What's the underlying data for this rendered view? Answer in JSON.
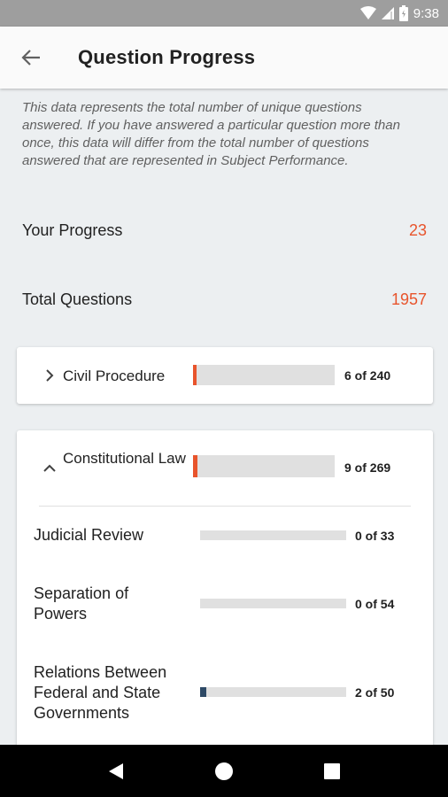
{
  "status_bar": {
    "time": "9:38"
  },
  "app_bar": {
    "title": "Question Progress"
  },
  "disclaimer": "This data represents the total number of unique questions answered. If you have answered a particular question more than once, this data will differ from the total number of questions answered that are represented in Subject Performance.",
  "stats": {
    "progress_label": "Your Progress",
    "progress_value": "23",
    "total_label": "Total Questions",
    "total_value": "1957"
  },
  "subjects": [
    {
      "label": "Civil Procedure",
      "count": "6 of 240",
      "answered": 6,
      "total": 240,
      "expanded": false
    },
    {
      "label": "Constitutional Law",
      "count": "9 of 269",
      "answered": 9,
      "total": 269,
      "expanded": true,
      "topics": [
        {
          "label": "Judicial Review",
          "count": "0 of 33",
          "answered": 0,
          "total": 33
        },
        {
          "label": "Separation of Powers",
          "count": "0 of 54",
          "answered": 0,
          "total": 54
        },
        {
          "label": "Relations Between Federal and State Governments",
          "count": "2 of 50",
          "answered": 2,
          "total": 50
        }
      ]
    }
  ],
  "colors": {
    "accent": "#e8542c",
    "topic_fill": "#2e4a66",
    "track": "#e0e0e0"
  }
}
